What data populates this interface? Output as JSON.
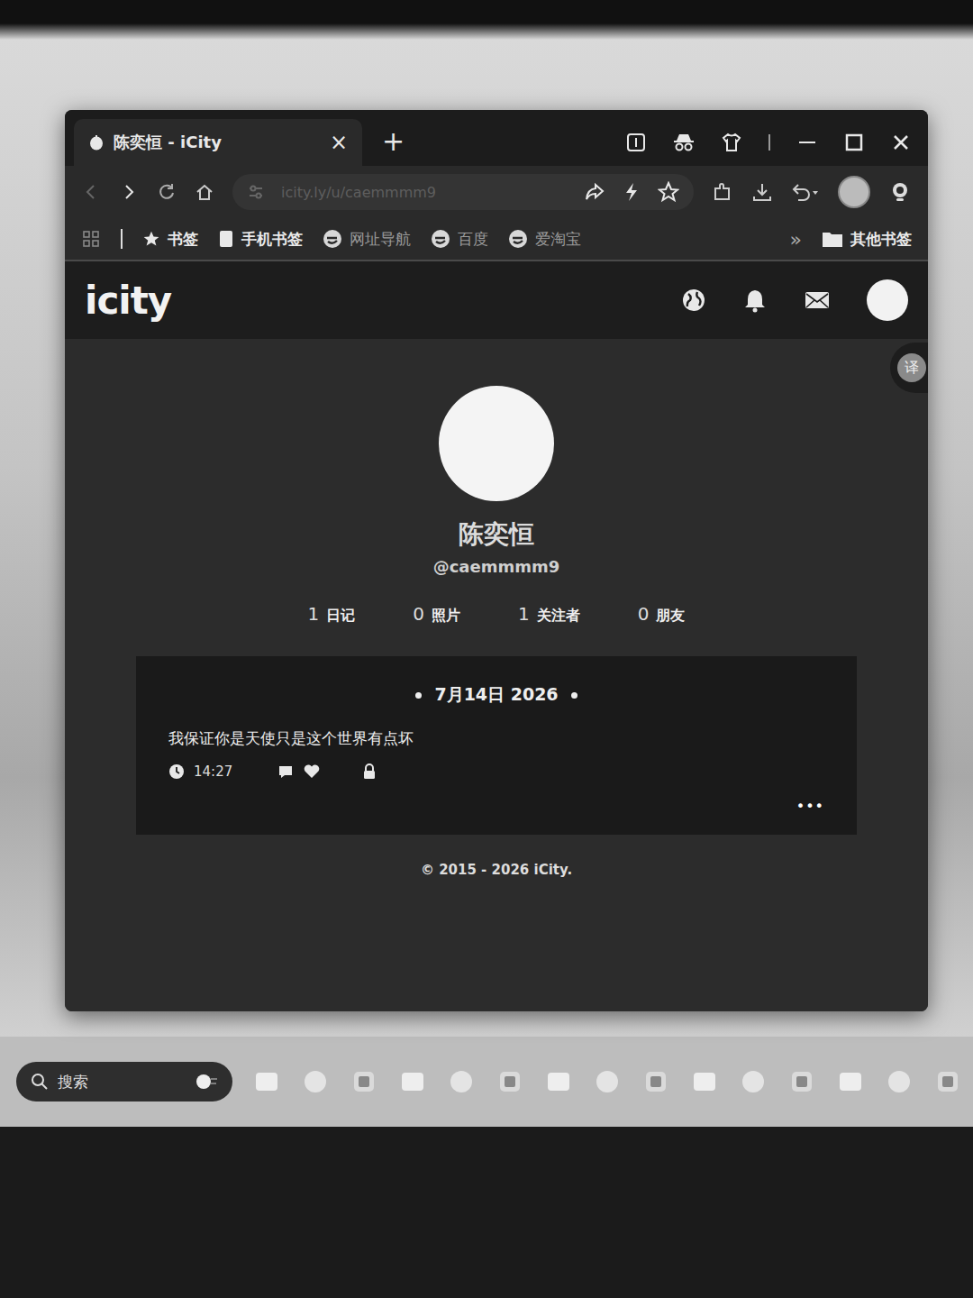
{
  "browser": {
    "tab": {
      "title": "陈奕恒 - iCity",
      "close": "×"
    },
    "new_tab": "+",
    "url": "icity.ly/u/caemmmm9",
    "bookmarks": [
      {
        "label": "书签",
        "kind": "star"
      },
      {
        "label": "手机书签",
        "kind": "page"
      },
      {
        "label": "网址导航",
        "kind": "site"
      },
      {
        "label": "百度",
        "kind": "site"
      },
      {
        "label": "爱淘宝",
        "kind": "site"
      }
    ],
    "more_bookmarks": "»",
    "other_bookmarks": "其他书签",
    "translate": "译"
  },
  "site": {
    "logo": "icity"
  },
  "profile": {
    "name": "陈奕恒",
    "handle": "@caemmmm9",
    "stats": [
      {
        "count": "1",
        "label": "日记"
      },
      {
        "count": "0",
        "label": "照片"
      },
      {
        "count": "1",
        "label": "关注者"
      },
      {
        "count": "0",
        "label": "朋友"
      }
    ]
  },
  "diary": [
    {
      "date": "7月14日 2026",
      "text": "我保证你是天使只是这个世界有点坏",
      "time": "14:27",
      "private": true,
      "more": "•••"
    }
  ],
  "footer": "© 2015 - 2026 iCity.",
  "taskbar": {
    "search": "搜索"
  }
}
